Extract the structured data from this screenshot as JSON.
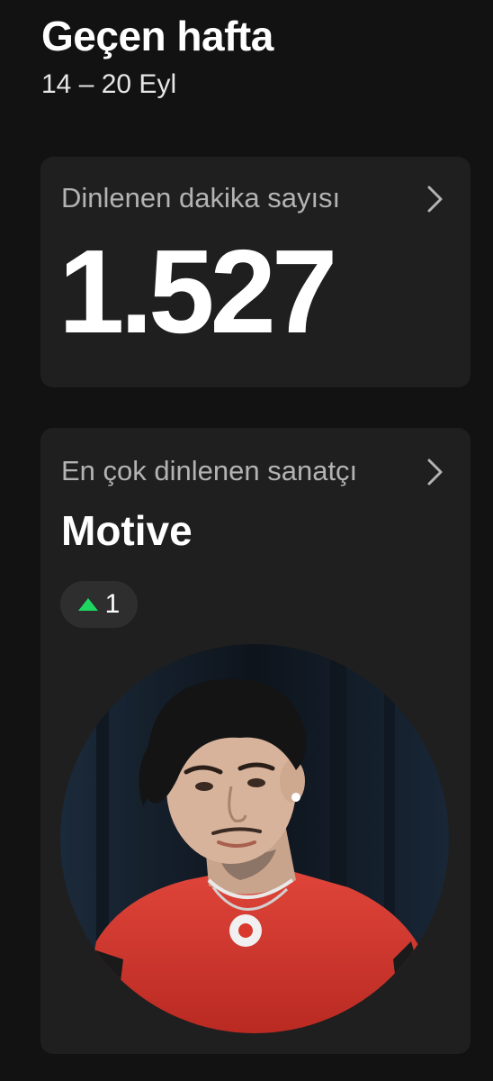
{
  "header": {
    "title": "Geçen hafta",
    "subtitle": "14 – 20 Eyl"
  },
  "minutes_card": {
    "label": "Dinlenen dakika sayısı",
    "value": "1.527",
    "chevron_icon": "chevron-right-icon"
  },
  "artist_card": {
    "label": "En çok dinlenen sanatçı",
    "artist_name": "Motive",
    "rank_change": "1",
    "rank_icon": "triangle-up-icon",
    "chevron_icon": "chevron-right-icon"
  },
  "colors": {
    "background": "#121212",
    "card": "#1f1f1f",
    "pill": "#2e2e2e",
    "accent_green": "#1ed760",
    "muted_text": "#b3b3b3",
    "shirt_red": "#d9382c"
  }
}
